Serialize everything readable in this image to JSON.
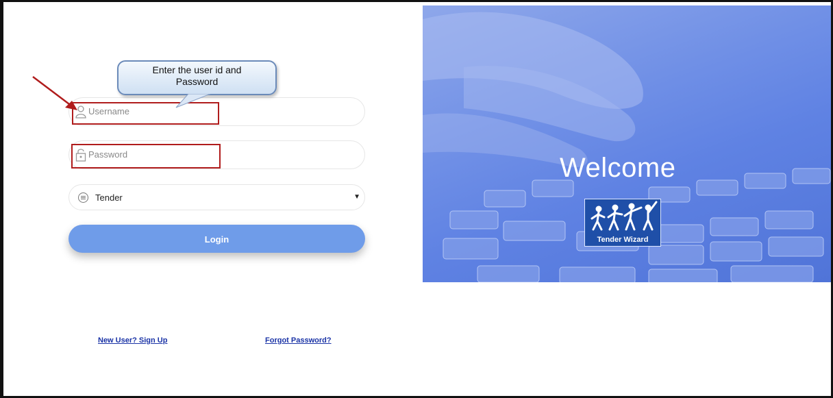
{
  "login_form": {
    "username_placeholder": "Username",
    "password_placeholder": "Password",
    "category_selected": "Tender",
    "login_label": "Login",
    "signup_link": "New User? Sign Up",
    "forgot_link": "Forgot Password?"
  },
  "annotation": {
    "callout_line1": "Enter the user id and",
    "callout_line2": "Password"
  },
  "hero": {
    "welcome_text": "Welcome",
    "logo_caption": "Tender Wizard"
  },
  "colors": {
    "login_button": "#6f9ce9",
    "hero_blue": "#5f82e3",
    "highlight_red": "#b01c1c",
    "link_blue": "#1a33a6"
  },
  "icons": [
    "user-icon",
    "lock-icon",
    "list-icon",
    "caret-down-icon",
    "arrow-annotation-icon"
  ]
}
